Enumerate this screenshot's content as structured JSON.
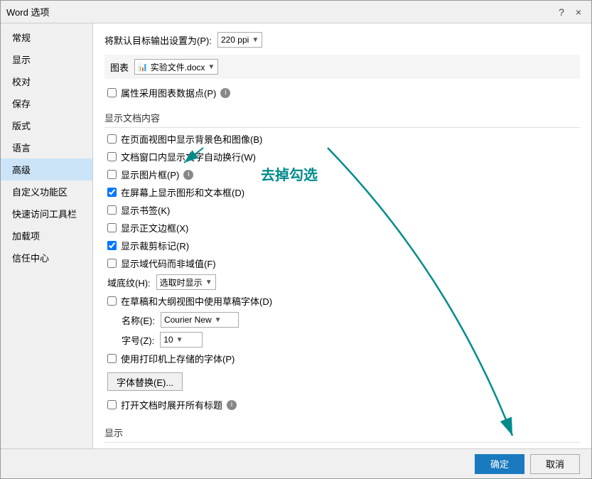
{
  "dialog": {
    "title": "Word 选项",
    "help_btn": "?",
    "close_btn": "×"
  },
  "sidebar": {
    "items": [
      {
        "id": "general",
        "label": "常规",
        "active": false
      },
      {
        "id": "display",
        "label": "显示",
        "active": false
      },
      {
        "id": "proofing",
        "label": "校对",
        "active": false
      },
      {
        "id": "save",
        "label": "保存",
        "active": false
      },
      {
        "id": "format",
        "label": "版式",
        "active": false
      },
      {
        "id": "language",
        "label": "语言",
        "active": false
      },
      {
        "id": "advanced",
        "label": "高级",
        "active": true
      },
      {
        "id": "customize",
        "label": "自定义功能区",
        "active": false
      },
      {
        "id": "quick_access",
        "label": "快速访问工具栏",
        "active": false
      },
      {
        "id": "addins",
        "label": "加载项",
        "active": false
      },
      {
        "id": "trust_center",
        "label": "信任中心",
        "active": false
      }
    ]
  },
  "content": {
    "dpi_label": "将默认目标输出设置为(P):",
    "dpi_value": "220 ppi",
    "chart_label": "图表",
    "chart_file": "实验文件.docx",
    "checkbox_use_chart_data": {
      "label": "属性采用图表数据点(P)",
      "checked": false
    },
    "section_show_doc": "显示文档内容",
    "checkbox_bg_color": {
      "label": "在页面视图中显示背景色和图像(B)",
      "checked": false
    },
    "checkbox_text_scroll": {
      "label": "文档窗口内显示文字自动换行(W)",
      "checked": false
    },
    "checkbox_show_pic": {
      "label": "显示图片框(P)",
      "checked": false
    },
    "checkbox_show_shapes": {
      "label": "在屏幕上显示图形和文本框(D)",
      "checked": true
    },
    "checkbox_bookmarks": {
      "label": "显示书签(K)",
      "checked": false
    },
    "checkbox_border": {
      "label": "显示正文边框(X)",
      "checked": false
    },
    "checkbox_crop_marks": {
      "label": "显示裁剪标记(R)",
      "checked": true
    },
    "checkbox_field_codes": {
      "label": "显示域代码而非域值(F)",
      "checked": false
    },
    "field_shading_label": "域底纹(H):",
    "field_shading_value": "选取时显示",
    "checkbox_draft_font": {
      "label": "在草稿和大纲视图中使用草稿字体(D)",
      "checked": false
    },
    "font_name_label": "名称(E):",
    "font_name_value": "Courier New",
    "font_size_label": "字号(Z):",
    "font_size_value": "10",
    "checkbox_printer_font": {
      "label": "使用打印机上存储的字体(P)",
      "checked": false
    },
    "font_sub_btn": "字体替换(E)...",
    "checkbox_expand_titles": {
      "label": "打开文档时展开所有标题",
      "checked": false
    },
    "section_display": "显示",
    "annotation": {
      "text": "去掉勾选",
      "color": "#008B8B"
    }
  },
  "footer": {
    "ok_label": "确定",
    "cancel_label": "取消"
  }
}
